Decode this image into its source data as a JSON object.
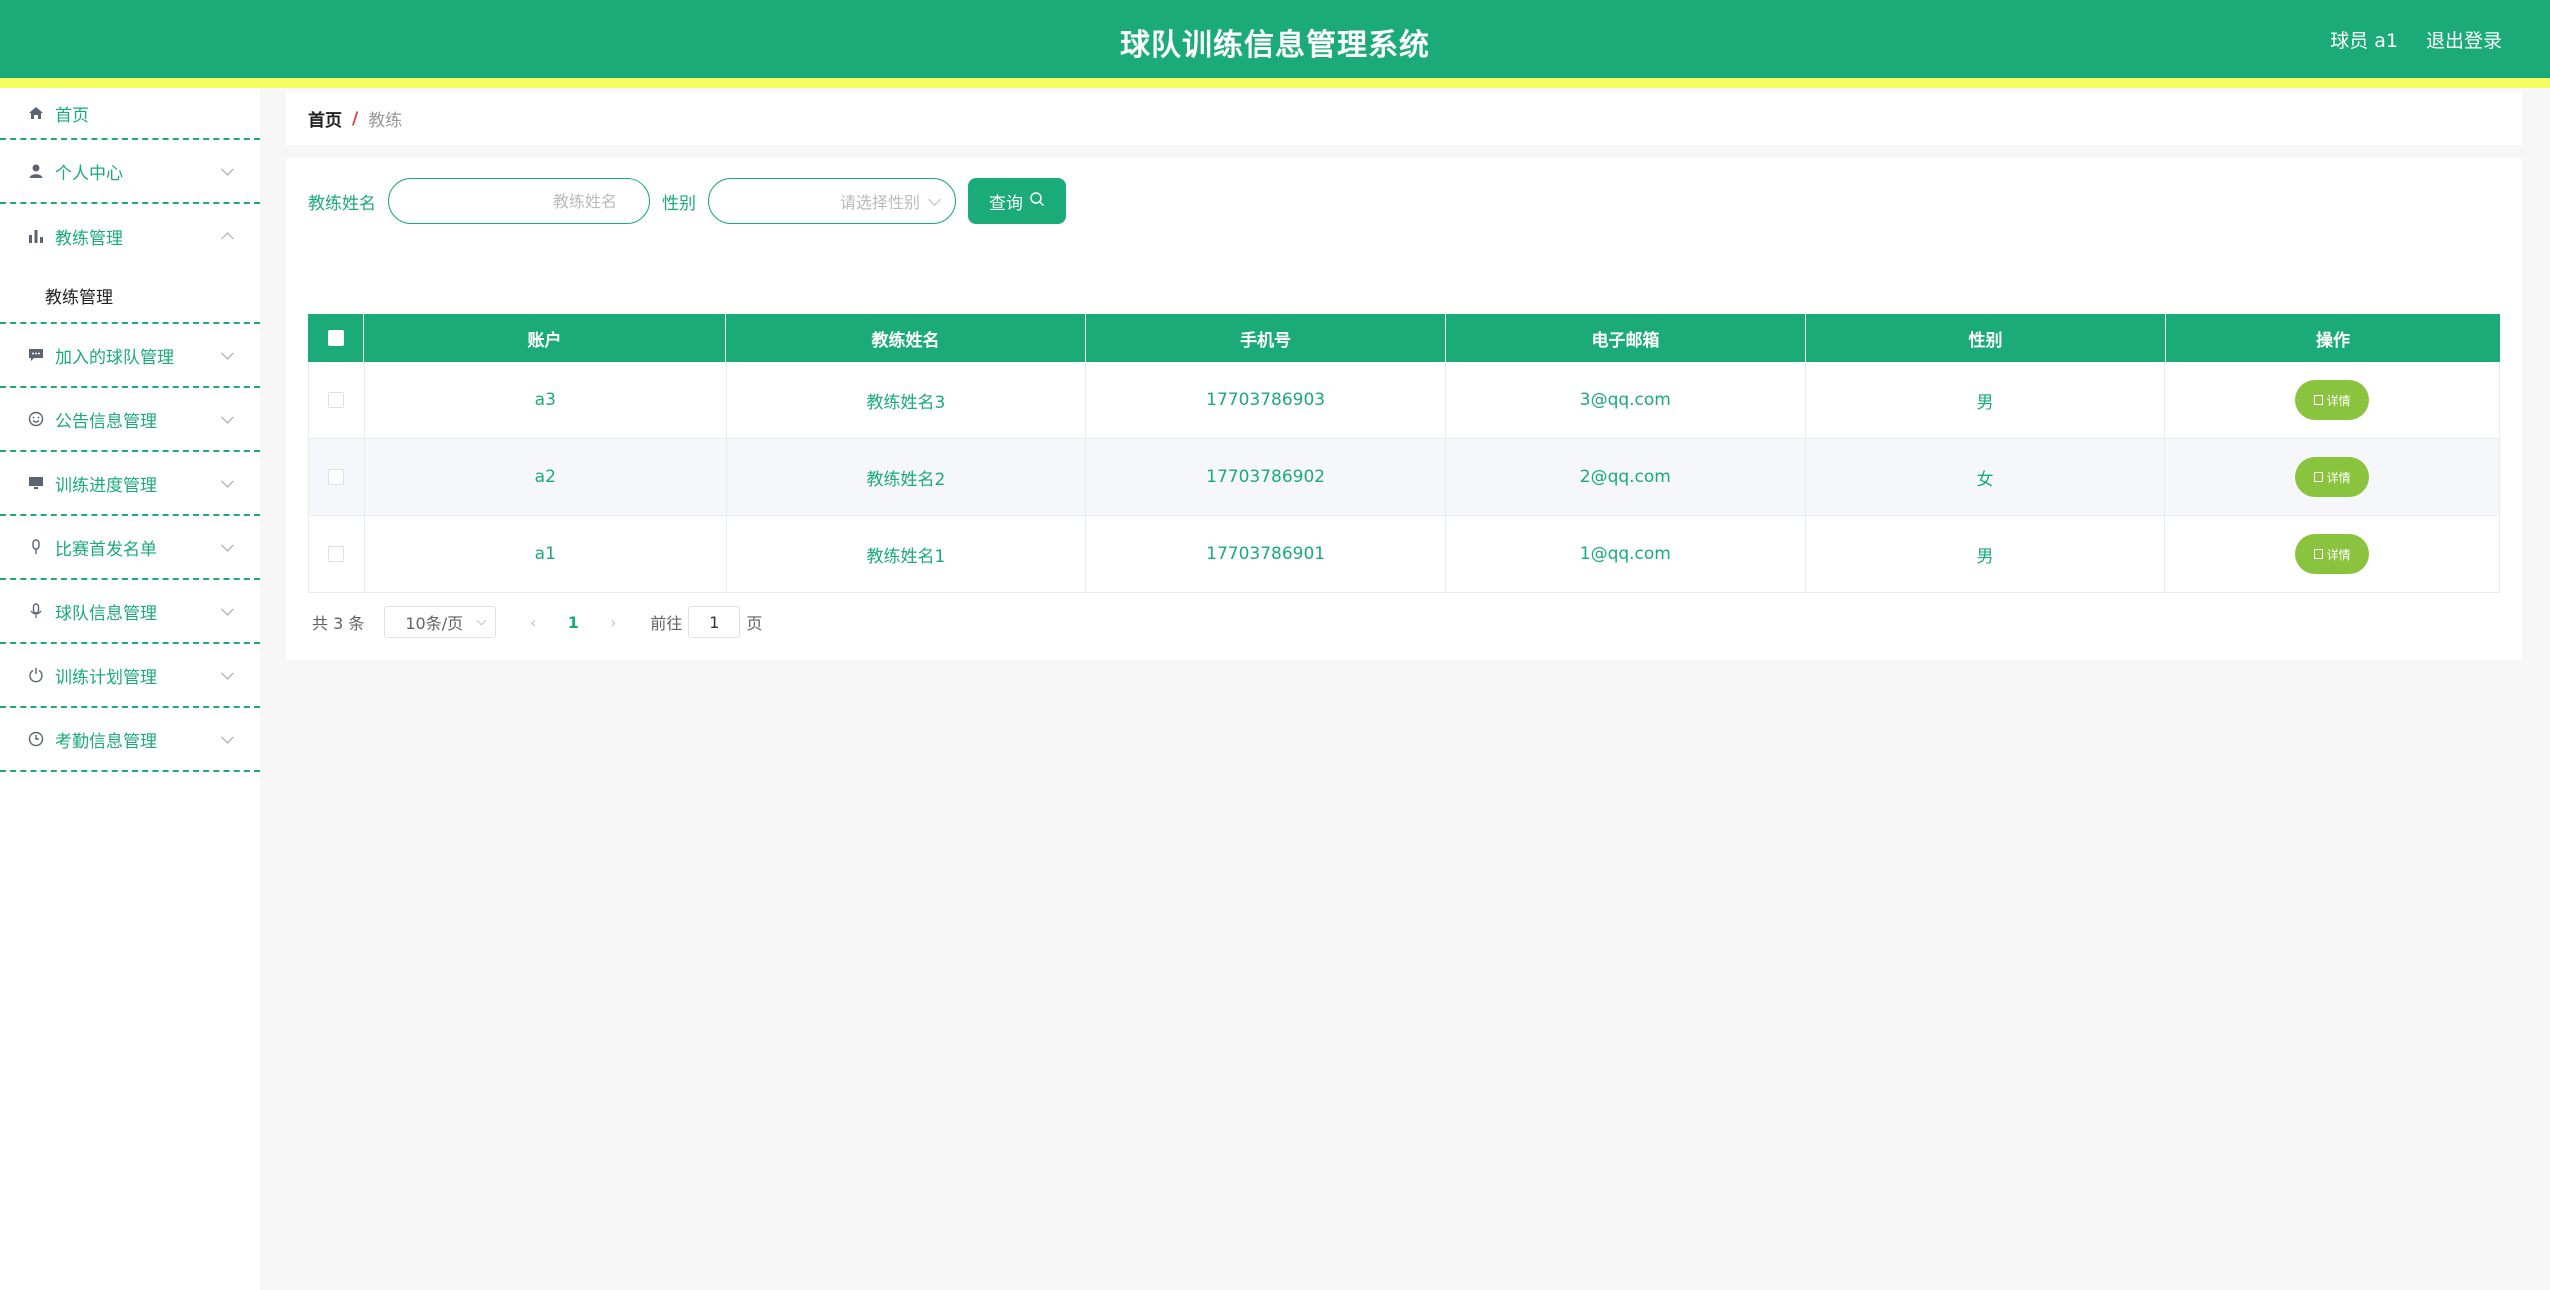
{
  "header": {
    "title": "球队训练信息管理系统",
    "user": "球员 a1",
    "logout": "退出登录"
  },
  "sidebar": {
    "items": [
      {
        "label": "首页",
        "icon": "home-icon"
      },
      {
        "label": "个人中心",
        "icon": "user-icon"
      },
      {
        "label": "教练管理",
        "icon": "bar-chart-icon",
        "open": true,
        "children": [
          "教练管理"
        ]
      },
      {
        "label": "加入的球队管理",
        "icon": "message-icon"
      },
      {
        "label": "公告信息管理",
        "icon": "smile-icon"
      },
      {
        "label": "训练进度管理",
        "icon": "monitor-icon"
      },
      {
        "label": "比赛首发名单",
        "icon": "microphone-icon"
      },
      {
        "label": "球队信息管理",
        "icon": "mic-icon"
      },
      {
        "label": "训练计划管理",
        "icon": "power-icon"
      },
      {
        "label": "考勤信息管理",
        "icon": "clock-icon"
      }
    ]
  },
  "breadcrumb": {
    "home": "首页",
    "separator": "/",
    "current": "教练"
  },
  "search": {
    "name_label": "教练姓名",
    "name_placeholder": "教练姓名",
    "gender_label": "性别",
    "gender_placeholder": "请选择性别",
    "query_label": "查询"
  },
  "table": {
    "columns": [
      "账户",
      "教练姓名",
      "手机号",
      "电子邮箱",
      "性别",
      "操作"
    ],
    "rows": [
      {
        "account": "a3",
        "name": "教练姓名3",
        "phone": "17703786903",
        "email": "3@qq.com",
        "gender": "男",
        "action": "详情"
      },
      {
        "account": "a2",
        "name": "教练姓名2",
        "phone": "17703786902",
        "email": "2@qq.com",
        "gender": "女",
        "action": "详情"
      },
      {
        "account": "a1",
        "name": "教练姓名1",
        "phone": "17703786901",
        "email": "1@qq.com",
        "gender": "男",
        "action": "详情"
      }
    ]
  },
  "pagination": {
    "total": "共 3 条",
    "page_size": "10条/页",
    "current_page": "1",
    "goto_label": "前往",
    "goto_value": "1",
    "page_unit": "页"
  },
  "colors": {
    "primary": "#1aab78",
    "stripe": "#f3ff5f",
    "detail_button": "#8ac33e"
  }
}
